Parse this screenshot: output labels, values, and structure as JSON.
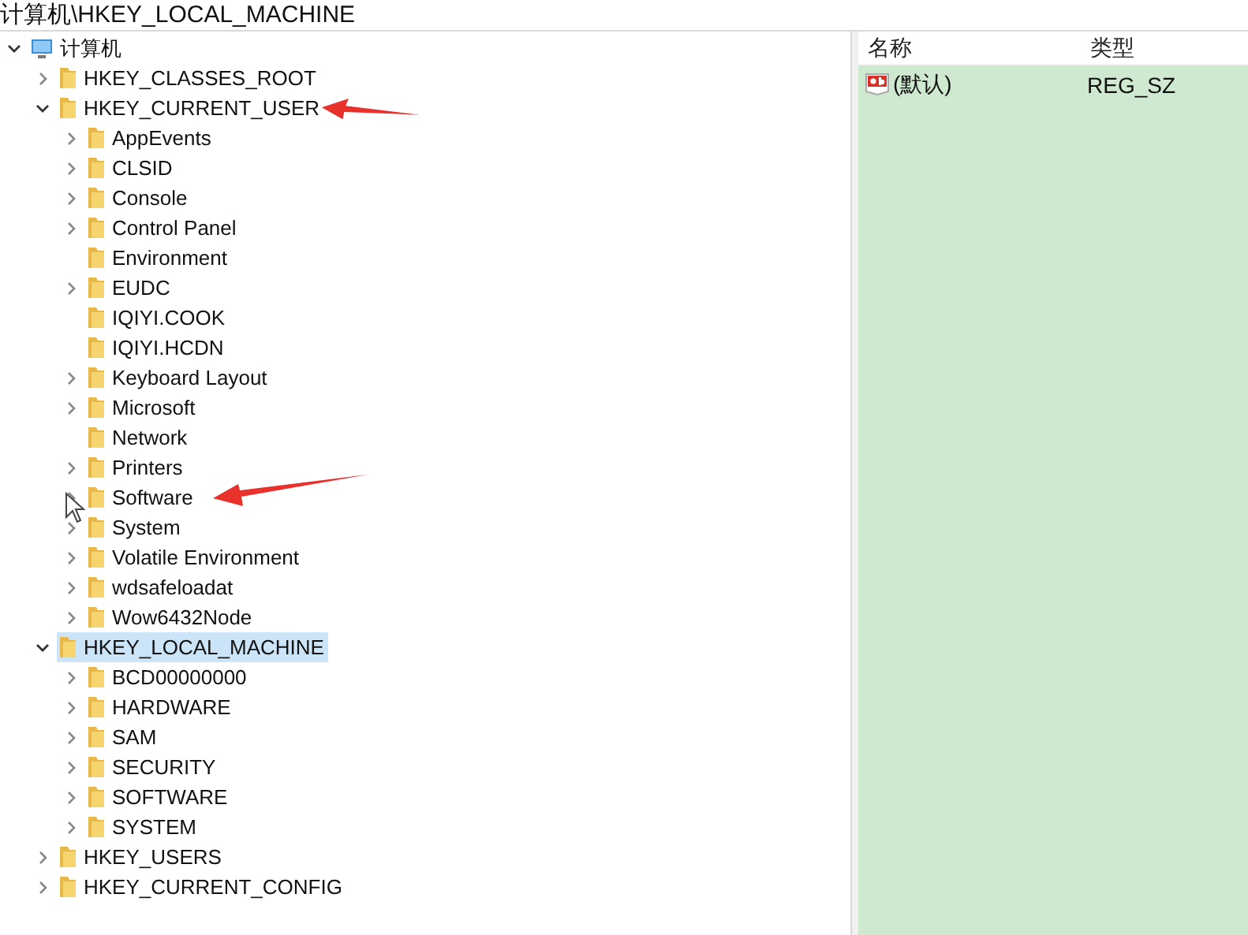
{
  "address_bar": {
    "path": "计算机\\HKEY_LOCAL_MACHINE"
  },
  "tree": {
    "label": "计算机",
    "kind": "computer",
    "expandable": true,
    "expanded": true,
    "selected": false,
    "children": [
      {
        "label": "HKEY_CLASSES_ROOT",
        "kind": "folder",
        "expandable": true,
        "selected": false
      },
      {
        "label": "HKEY_CURRENT_USER",
        "kind": "folder",
        "expandable": true,
        "expanded": true,
        "selected": false,
        "children": [
          {
            "label": "AppEvents",
            "kind": "folder",
            "expandable": true,
            "selected": false
          },
          {
            "label": "CLSID",
            "kind": "folder",
            "expandable": true,
            "selected": false
          },
          {
            "label": "Console",
            "kind": "folder",
            "expandable": true,
            "selected": false
          },
          {
            "label": "Control Panel",
            "kind": "folder",
            "expandable": true,
            "selected": false
          },
          {
            "label": "Environment",
            "kind": "folder",
            "expandable": false,
            "selected": false
          },
          {
            "label": "EUDC",
            "kind": "folder",
            "expandable": true,
            "selected": false
          },
          {
            "label": "IQIYI.COOK",
            "kind": "folder",
            "expandable": false,
            "selected": false
          },
          {
            "label": "IQIYI.HCDN",
            "kind": "folder",
            "expandable": false,
            "selected": false
          },
          {
            "label": "Keyboard Layout",
            "kind": "folder",
            "expandable": true,
            "selected": false
          },
          {
            "label": "Microsoft",
            "kind": "folder",
            "expandable": true,
            "selected": false
          },
          {
            "label": "Network",
            "kind": "folder",
            "expandable": false,
            "selected": false
          },
          {
            "label": "Printers",
            "kind": "folder",
            "expandable": true,
            "selected": false
          },
          {
            "label": "Software",
            "kind": "folder",
            "expandable": true,
            "selected": false
          },
          {
            "label": "System",
            "kind": "folder",
            "expandable": true,
            "selected": false
          },
          {
            "label": "Volatile Environment",
            "kind": "folder",
            "expandable": true,
            "selected": false
          },
          {
            "label": "wdsafeloadat",
            "kind": "folder",
            "expandable": true,
            "selected": false
          },
          {
            "label": "Wow6432Node",
            "kind": "folder",
            "expandable": true,
            "selected": false
          }
        ]
      },
      {
        "label": "HKEY_LOCAL_MACHINE",
        "kind": "folder",
        "expandable": true,
        "expanded": true,
        "selected": true,
        "children": [
          {
            "label": "BCD00000000",
            "kind": "folder",
            "expandable": true,
            "selected": false
          },
          {
            "label": "HARDWARE",
            "kind": "folder",
            "expandable": true,
            "selected": false
          },
          {
            "label": "SAM",
            "kind": "folder",
            "expandable": true,
            "selected": false
          },
          {
            "label": "SECURITY",
            "kind": "folder",
            "expandable": true,
            "selected": false
          },
          {
            "label": "SOFTWARE",
            "kind": "folder",
            "expandable": true,
            "selected": false
          },
          {
            "label": "SYSTEM",
            "kind": "folder",
            "expandable": true,
            "selected": false
          }
        ]
      },
      {
        "label": "HKEY_USERS",
        "kind": "folder",
        "expandable": true,
        "selected": false
      },
      {
        "label": "HKEY_CURRENT_CONFIG",
        "kind": "folder",
        "expandable": true,
        "selected": false
      }
    ]
  },
  "values_list": {
    "columns": [
      "名称",
      "类型"
    ],
    "rows": [
      {
        "name": "(默认)",
        "type": "REG_SZ",
        "selected": false
      }
    ]
  }
}
